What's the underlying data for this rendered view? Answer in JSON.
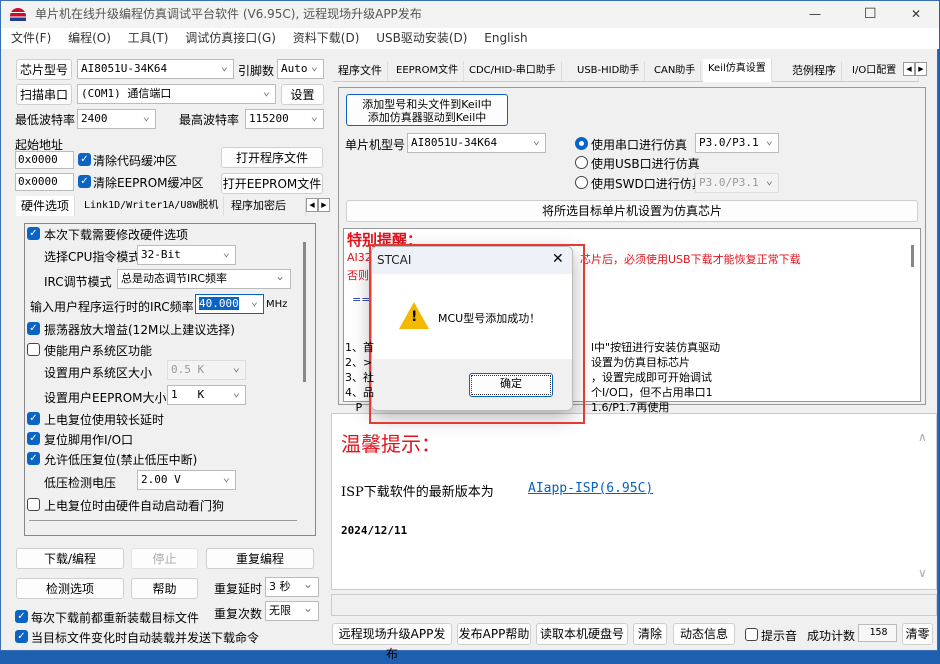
{
  "window": {
    "title": "单片机在线升级编程仿真调试平台软件 (V6.95C), 远程现场升级APP发布",
    "minimize": "—",
    "maximize": "☐",
    "close": "✕"
  },
  "menu": [
    "文件(F)",
    "编程(O)",
    "工具(T)",
    "调试仿真接口(G)",
    "资料下载(D)",
    "USB驱动安装(D)",
    "English"
  ],
  "left": {
    "chip_btn": "芯片型号",
    "chip_value": "AI8051U-34K64",
    "pins_label": "引脚数",
    "pins_value": "Auto",
    "scan_btn": "扫描串口",
    "port_value": "(COM1) 通信端口",
    "settings_btn": "设置",
    "min_baud_label": "最低波特率",
    "min_baud": "2400",
    "max_baud_label": "最高波特率",
    "max_baud": "115200",
    "start_addr_label": "起始地址",
    "addr1": "0x0000",
    "clear_code": "清除代码缓冲区",
    "addr2": "0x0000",
    "clear_eeprom": "清除EEPROM缓冲区",
    "open_prog": "打开程序文件",
    "open_eeprom": "打开EEPROM文件",
    "tabs": [
      "硬件选项",
      "Link1D/Writer1A/U8W脱机",
      "程序加密后"
    ],
    "hw": {
      "modify": "本次下载需要修改硬件选项",
      "cpu_mode_label": "选择CPU指令模式",
      "cpu_mode": "32-Bit",
      "irc_mode_label": "IRC调节模式",
      "irc_mode": "总是动态调节IRC频率",
      "irc_freq_label": "输入用户程序运行时的IRC频率",
      "irc_freq": "40.000",
      "mhz": "MHz",
      "osc_gain": "振荡器放大增益(12M以上建议选择)",
      "user_sys": "使能用户系统区功能",
      "sys_size_label": "设置用户系统区大小",
      "sys_size": "0.5 K",
      "eeprom_size_label": "设置用户EEPROM大小",
      "eeprom_size": "1   K",
      "long_delay": "上电复位使用较长延时",
      "reset_io": "复位脚用作I/O口",
      "lvr": "允许低压复位(禁止低压中断)",
      "lv_label": "低压检测电压",
      "lv": "2.00 V",
      "wdt": "上电复位时由硬件自动启动看门狗"
    },
    "download_btn": "下载/编程",
    "stop_btn": "停止",
    "repeat_btn": "重复编程",
    "check_btn": "检测选项",
    "help_btn": "帮助",
    "repeat_delay_label": "重复延时",
    "repeat_delay": "3 秒",
    "repeat_count_label": "重复次数",
    "repeat_count": "无限",
    "reload": "每次下载前都重新装载目标文件",
    "auto_send": "当目标文件变化时自动装载并发送下载命令"
  },
  "right": {
    "tabs": [
      "程序文件",
      "EEPROM文件",
      "CDC/HID-串口助手",
      "USB-HID助手",
      "CAN助手",
      "Keil仿真设置",
      "范例程序",
      "I/O口配置"
    ],
    "keil_btn_line1": "添加型号和头文件到Keil中",
    "keil_btn_line2": "添加仿真器驱动到Keil中",
    "mcu_label": "单片机型号",
    "mcu_value": "AI8051U-34K64",
    "radio_serial": "使用串口进行仿真",
    "serial_port": "P3.0/P3.1",
    "radio_usb": "使用USB口进行仿真",
    "radio_swd": "使用SWD口进行仿真",
    "swd_port": "P3.0/P3.1",
    "set_target_btn": "将所选目标单片机设置为仿真芯片",
    "notice_title": "特别提醒：",
    "notice_l1a": "AI32",
    "notice_l1b": "芯片后，必须使用USB下载才能恢复正常下载",
    "notice_l2a": "否则",
    "arrow": "==>",
    "steps_left": [
      "1、首",
      "2、>",
      "3、社",
      "4、品",
      "   P"
    ],
    "steps_right": [
      "l中\"按钮进行安装仿真驱动",
      "设置为仿真目标芯片",
      "，设置完成即可开始调试",
      "个I/O口，但不占用串口1",
      "1.6/P1.7再使用"
    ],
    "tip_title": "温馨提示：",
    "tip_text": "ISP下载软件的最新版本为",
    "tip_link": "AIapp-ISP(6.95C)",
    "tip_date": "2024/12/11",
    "bottom": {
      "publish": "远程现场升级APP发布",
      "publish_help": "发布APP帮助",
      "read_disk": "读取本机硬盘号",
      "clear": "清除",
      "dynamic": "动态信息",
      "sound": "提示音",
      "count_label": "成功计数",
      "count": "158",
      "reset": "清零"
    }
  },
  "dialog": {
    "title": "STCAI",
    "close": "✕",
    "message": "MCU型号添加成功！",
    "ok": "确定"
  },
  "colors": {
    "accent": "#0b63c4",
    "red": "#e0141e",
    "link": "#0563c1",
    "highlight": "#e53935"
  }
}
